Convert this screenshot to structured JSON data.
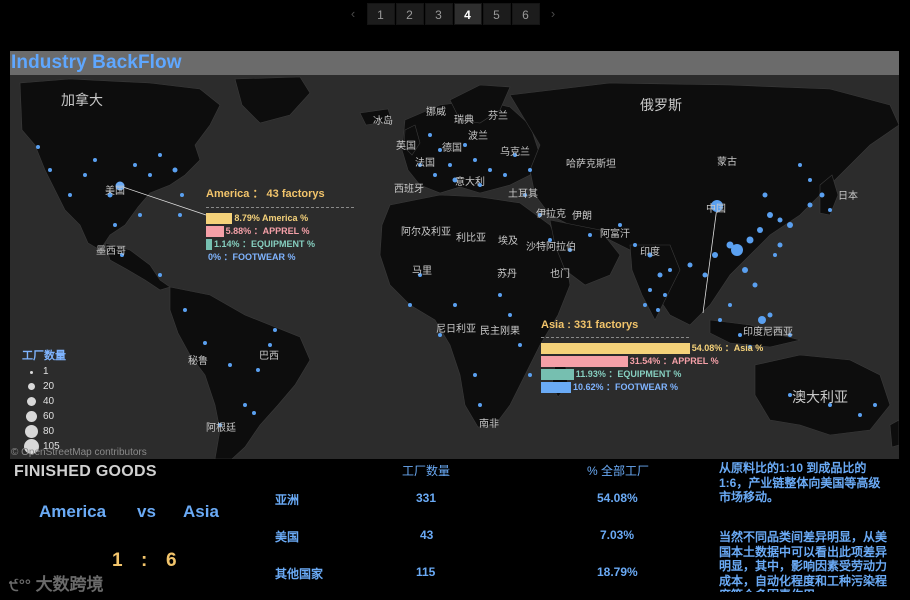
{
  "pagination": {
    "prev_icon": "‹",
    "next_icon": "›",
    "pages": [
      "1",
      "2",
      "3",
      "4",
      "5",
      "6"
    ],
    "active": "4"
  },
  "title": "Industry BackFlow",
  "map": {
    "attribution": "© OpenStreetMap contributors",
    "labels": [
      "加拿大",
      "美国",
      "墨西哥",
      "秘鲁",
      "巴西",
      "阿根廷",
      "冰岛",
      "挪威",
      "瑞典",
      "芬兰",
      "英国",
      "波兰",
      "乌克兰",
      "法国",
      "西班牙",
      "德国",
      "意大利",
      "土耳其",
      "哈萨克斯坦",
      "俄罗斯",
      "蒙古",
      "中国",
      "伊拉克",
      "伊朗",
      "阿富汗",
      "印度",
      "沙特阿拉伯",
      "阿尔及利亚",
      "利比亚",
      "埃及",
      "苏丹",
      "也门",
      "尼日利亚",
      "民主刚果",
      "南非",
      "澳大利亚",
      "马里",
      "印度尼西亚",
      "日本"
    ],
    "legend": {
      "title": "工厂数量",
      "values": [
        "1",
        "20",
        "40",
        "60",
        "80",
        "105"
      ]
    },
    "callouts": {
      "america": {
        "title": "America ： 43 factorys",
        "bars": [
          {
            "pct": 8.79,
            "label": "8.79% America %",
            "color": "#f5d27a",
            "text_color": "#f5d27a"
          },
          {
            "pct": 5.88,
            "label": "5.88% ：APPREL %",
            "color": "#f5a0a8",
            "text_color": "#f5a0a8"
          },
          {
            "pct": 1.14,
            "label": "1.14% ：EQUIPMENT %",
            "color": "#76bfb0",
            "text_color": "#86cfc0"
          },
          {
            "pct": 0,
            "label": "0% ：FOOTWEAR %",
            "color": "#6aaaf5",
            "text_color": "#7fb4ff"
          }
        ]
      },
      "asia": {
        "title": "Asia : 331  factorys",
        "bars": [
          {
            "pct": 54.08,
            "label": "54.08%   ：Asia %",
            "color": "#f5d27a",
            "text_color": "#f5d27a"
          },
          {
            "pct": 31.54,
            "label": "31.54% ：APPREL %",
            "color": "#f5a0a8",
            "text_color": "#f5a0a8"
          },
          {
            "pct": 11.93,
            "label": "11.93% ：EQUIPMENT %",
            "color": "#76bfb0",
            "text_color": "#86cfc0"
          },
          {
            "pct": 10.62,
            "label": "10.62% ：FOOTWEAR %",
            "color": "#6aaaf5",
            "text_color": "#7fb4ff"
          }
        ]
      }
    }
  },
  "summary": {
    "title": "FINISHED GOODS",
    "left": "America",
    "vs": "vs",
    "right": "Asia",
    "ratio_left": "1",
    "ratio_sep": ":",
    "ratio_right": "6"
  },
  "table": {
    "headers": [
      "工厂数量",
      "% 全部工厂"
    ],
    "rows": [
      {
        "region": "亚洲",
        "count": "331",
        "pct": "54.08%"
      },
      {
        "region": "美国",
        "count": "43",
        "pct": "7.03%"
      },
      {
        "region": "其他国家",
        "count": "115",
        "pct": "18.79%"
      }
    ]
  },
  "notes": [
    "从原料比的1:10 到成品比的1:6，产业链整体向美国等高级市场移动。",
    "当然不同品类间差异明显，从美国本土数据中可以看出此项差异明显，其中，影响因素受劳动力成本，自动化程度和工种污染程度等众多因素作用"
  ],
  "logo": "大数跨境",
  "colors": {
    "accent_blue": "#6aaaf5",
    "gold": "#f2c46b",
    "map_land": "#0d0d0d",
    "map_sea": "#2c2c2c",
    "factory_dot": "#5aa0f0"
  }
}
